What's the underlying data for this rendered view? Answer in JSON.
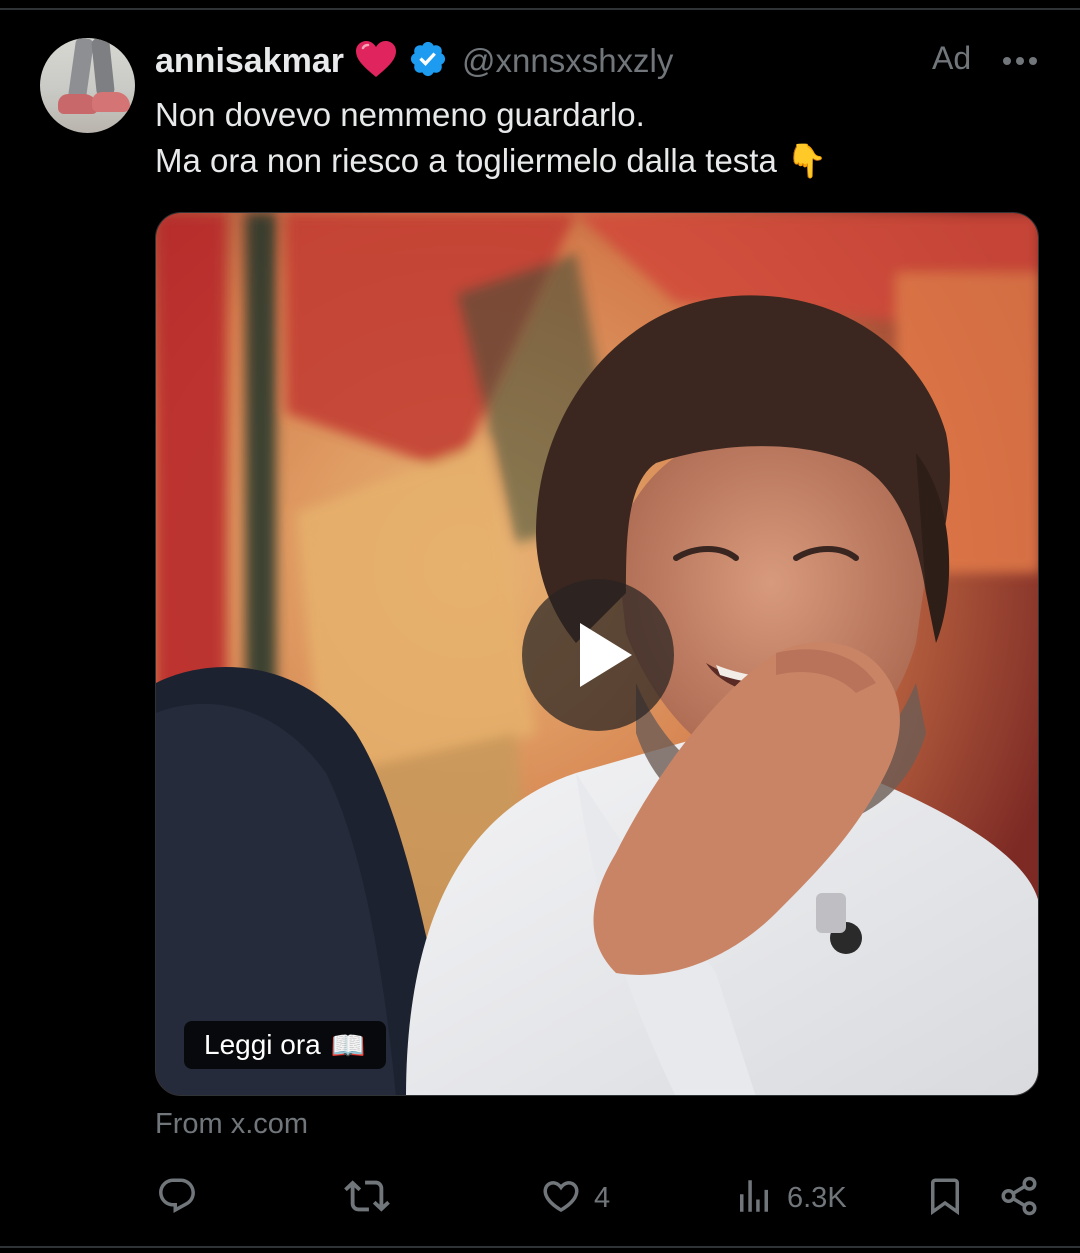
{
  "post": {
    "display_name": "annisakmar",
    "handle": "@xnnsxshxzly",
    "ad_label": "Ad",
    "text_line1": "Non dovevo nemmeno guardarlo.",
    "text_line2": "Ma ora non riesco a togliermelo dalla testa 👇",
    "media": {
      "cta_label": "Leggi ora",
      "cta_emoji": "📖"
    },
    "source": "From x.com"
  },
  "actions": {
    "like_count": "4",
    "views_count": "6.3K"
  },
  "colors": {
    "background": "#000000",
    "text_primary": "#e7e9ea",
    "text_secondary": "#71767b",
    "verified_badge": "#1d9bf0",
    "heart": "#e0245e"
  },
  "icons": [
    "heart-emoji-icon",
    "verified-badge-icon",
    "more-icon",
    "play-icon",
    "reply-icon",
    "repost-icon",
    "like-icon",
    "views-icon",
    "bookmark-icon",
    "share-icon"
  ]
}
